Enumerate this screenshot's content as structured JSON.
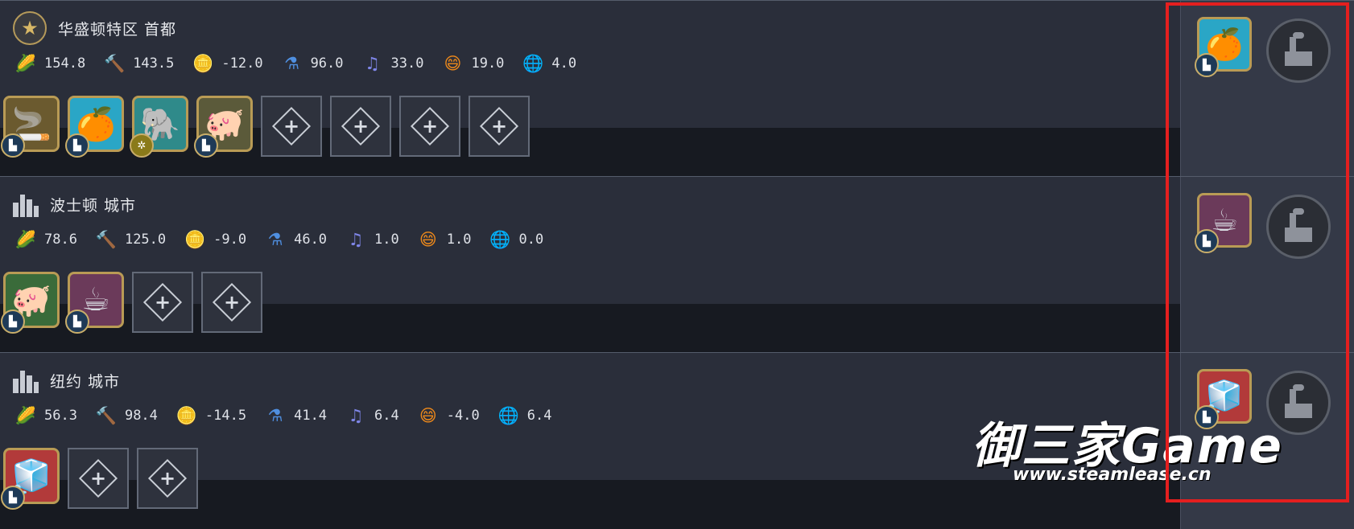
{
  "cities": [
    {
      "name": "华盛顿特区 首都",
      "badge": "star",
      "stats": {
        "food": "154.8",
        "production": "143.5",
        "gold": "-12.0",
        "science": "96.0",
        "culture": "33.0",
        "happiness": "19.0",
        "influence": "4.0"
      },
      "slots": [
        {
          "icon": "pipe-tobacco-icon",
          "glyph": "🚬",
          "bg": "#6b5a2f",
          "corner": "factory"
        },
        {
          "icon": "orange-citrus-icon",
          "glyph": "🍊",
          "bg": "#2aa6c6",
          "corner": "factory"
        },
        {
          "icon": "elephant-ivory-icon",
          "glyph": "🐘",
          "bg": "#2f8a8a",
          "corner": "gear"
        },
        {
          "icon": "pig-icon",
          "glyph": "🐖",
          "bg": "#5b5a3a",
          "corner": "factory"
        }
      ],
      "empty_slots": 4,
      "resource": {
        "icon": "orange-citrus-icon",
        "glyph": "🍊",
        "bg": "#2aa6c6"
      }
    },
    {
      "name": "波士顿 城市",
      "badge": "city",
      "stats": {
        "food": "78.6",
        "production": "125.0",
        "gold": "-9.0",
        "science": "46.0",
        "culture": "1.0",
        "happiness": "1.0",
        "influence": "0.0"
      },
      "slots": [
        {
          "icon": "pig-icon",
          "glyph": "🐖",
          "bg": "#3a6b3a",
          "corner": "factory"
        },
        {
          "icon": "tea-mug-icon",
          "glyph": "☕",
          "bg": "#6b3a5a",
          "corner": "factory"
        }
      ],
      "empty_slots": 2,
      "resource": {
        "icon": "tea-mug-icon",
        "glyph": "☕",
        "bg": "#6b3a5a"
      }
    },
    {
      "name": "纽约 城市",
      "badge": "city",
      "stats": {
        "food": "56.3",
        "production": "98.4",
        "gold": "-14.5",
        "science": "41.4",
        "culture": "6.4",
        "happiness": "-4.0",
        "influence": "6.4"
      },
      "slots": [
        {
          "icon": "sugar-cubes-icon",
          "glyph": "🧊",
          "bg": "#b23a3a",
          "corner": "factory"
        }
      ],
      "empty_slots": 2,
      "resource": {
        "icon": "sugar-cubes-icon",
        "glyph": "🧊",
        "bg": "#b23a3a"
      }
    }
  ],
  "watermark": {
    "title": "御三家Game",
    "url": "www.steamlease.cn"
  },
  "colors": {
    "highlight_box": "#e41f1f",
    "slot_border": "#b99b55",
    "panel": "#2a2e3a"
  }
}
